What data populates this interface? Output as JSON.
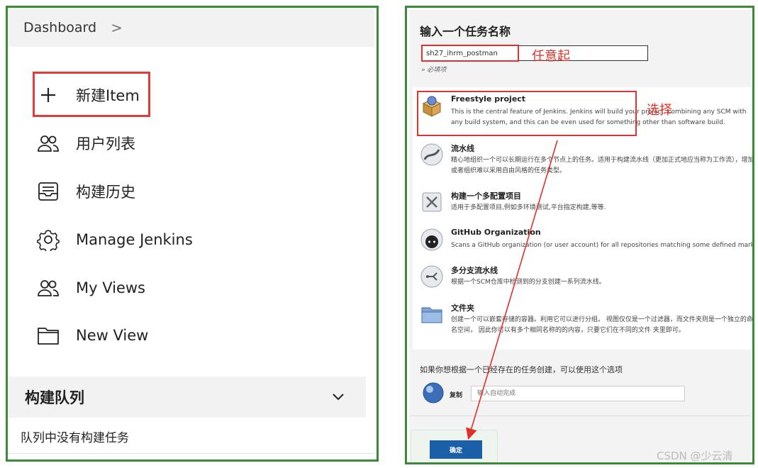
{
  "left": {
    "breadcrumb": "Dashboard",
    "breadcrumb_chevron": ">",
    "nav": [
      {
        "label": "新建Item",
        "icon": "plus-icon"
      },
      {
        "label": "用户列表",
        "icon": "people-icon"
      },
      {
        "label": "构建历史",
        "icon": "inbox-icon"
      },
      {
        "label": "Manage Jenkins",
        "icon": "gear-icon"
      },
      {
        "label": "My Views",
        "icon": "people-icon"
      },
      {
        "label": "New View",
        "icon": "folder-icon"
      }
    ],
    "queue": {
      "title": "构建队列",
      "empty": "队列中没有构建任务"
    }
  },
  "right": {
    "title": "输入一个任务名称",
    "name_value": "sh27_ihrm_postman",
    "required": "» 必填项",
    "annotation_name": "任意起",
    "annotation_select": "选择",
    "items": [
      {
        "title": "Freestyle project",
        "desc": "This is the central feature of Jenkins. Jenkins will build your project, combining any SCM with any build system, and this can be even used for something other than software build.",
        "icon": "freestyle-box-icon"
      },
      {
        "title": "流水线",
        "desc": "精心地组织一个可以长期运行在多个节点上的任务。适用于构建流水线（更加正式地应当称为工作流），增加或者组织难以采用自由风格的任务类型。",
        "icon": "pipeline-icon"
      },
      {
        "title": "构建一个多配置项目",
        "desc": "适用于多配置项目,例如多环境测试,平台指定构建,等等.",
        "icon": "multiconfig-icon"
      },
      {
        "title": "GitHub Organization",
        "desc": "Scans a GitHub organization (or user account) for all repositories matching some defined markers.",
        "icon": "github-icon"
      },
      {
        "title": "多分支流水线",
        "desc": "根据一个SCM仓库中检测到的分支创建一系列流水线。",
        "icon": "multibranch-icon"
      },
      {
        "title": "文件夹",
        "desc": "创建一个可以嵌套存储的容器。利用它可以进行分组。 视图仅仅是一个过滤器，而文件夹则是一个独立的命名空间， 因此你可以有多个相同名称的的内容，只要它们在不同的文件 夹里即可。",
        "icon": "folder-icon"
      }
    ],
    "copy_text": "如果你想根据一个已经存在的任务创建，可以使用这个选项",
    "copy_label": "复制",
    "copy_placeholder": "输入自动完成",
    "ok_label": "确定"
  },
  "watermark": "CSDN @少云清"
}
